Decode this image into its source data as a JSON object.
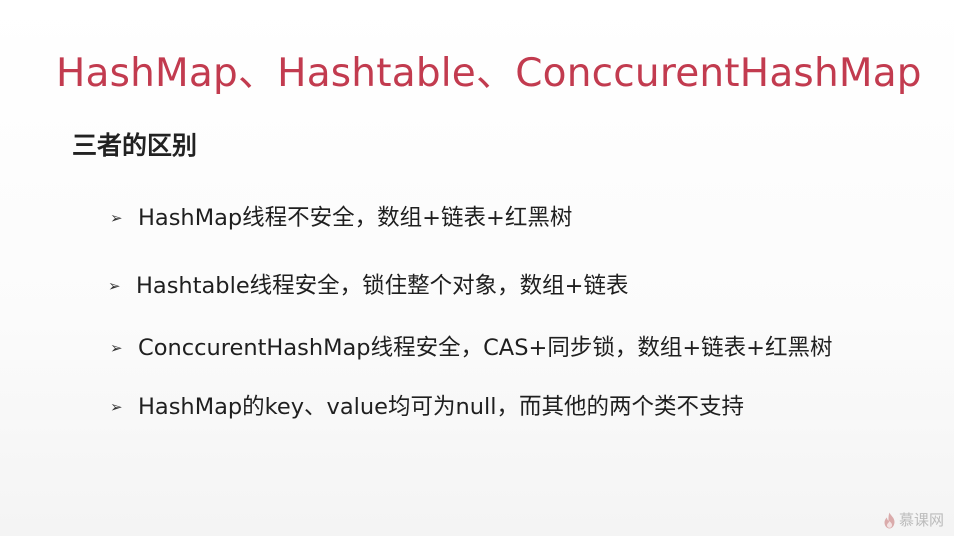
{
  "slide": {
    "title": "HashMap、Hashtable、ConccurentHashMap",
    "subtitle": "三者的区别",
    "bullet_marker": "➢",
    "bullets": [
      "HashMap线程不安全，数组+链表+红黑树",
      "Hashtable线程安全，锁住整个对象，数组+链表",
      "ConccurentHashMap线程安全，CAS+同步锁，数组+链表+红黑树",
      "HashMap的key、value均可为null，而其他的两个类不支持"
    ]
  },
  "watermark": {
    "text": "慕课网",
    "icon": "flame-logo-icon"
  },
  "colors": {
    "title": "#c23b4f",
    "text": "#1f1f1f",
    "background": "#ffffff",
    "watermark": "#b9b9b9"
  }
}
